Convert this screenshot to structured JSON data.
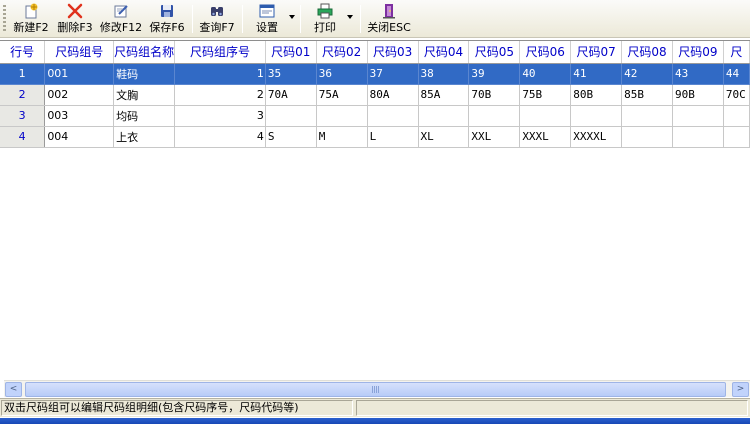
{
  "toolbar": {
    "buttons": [
      {
        "label": "新建F2",
        "icon": "new-document-icon"
      },
      {
        "label": "删除F3",
        "icon": "delete-x-icon"
      },
      {
        "label": "修改F12",
        "icon": "edit-icon"
      },
      {
        "label": "保存F6",
        "icon": "save-disk-icon"
      },
      {
        "label": "查询F7",
        "icon": "binoculars-icon"
      },
      {
        "label": "设置",
        "icon": "settings-window-icon"
      },
      {
        "label": "打印",
        "icon": "printer-icon"
      },
      {
        "label": "关闭ESC",
        "icon": "exit-door-icon"
      }
    ]
  },
  "grid": {
    "columns": [
      "行号",
      "尺码组号",
      "尺码组名称",
      "尺码组序号",
      "尺码01",
      "尺码02",
      "尺码03",
      "尺码04",
      "尺码05",
      "尺码06",
      "尺码07",
      "尺码08",
      "尺码09",
      "尺"
    ],
    "rows": [
      {
        "rn": "1",
        "code": "001",
        "name": "鞋码",
        "seq": "1",
        "sizes": [
          "35",
          "36",
          "37",
          "38",
          "39",
          "40",
          "41",
          "42",
          "43",
          "44"
        ],
        "selected": true
      },
      {
        "rn": "2",
        "code": "002",
        "name": "文胸",
        "seq": "2",
        "sizes": [
          "70A",
          "75A",
          "80A",
          "85A",
          "70B",
          "75B",
          "80B",
          "85B",
          "90B",
          "70C"
        ],
        "selected": false
      },
      {
        "rn": "3",
        "code": "003",
        "name": "均码",
        "seq": "3",
        "sizes": [
          "",
          "",
          "",
          "",
          "",
          "",
          "",
          "",
          "",
          ""
        ],
        "selected": false
      },
      {
        "rn": "4",
        "code": "004",
        "name": "上衣",
        "seq": "4",
        "sizes": [
          "S",
          "M",
          "L",
          "XL",
          "XXL",
          "XXXL",
          "XXXXL",
          "",
          "",
          ""
        ],
        "selected": false
      }
    ]
  },
  "scrollbar": {
    "left_arrow": "<",
    "right_arrow": ">"
  },
  "status": {
    "message": "双击尺码组可以编辑尺码组明细(包含尺码序号，尺码代码等)",
    "right": ""
  },
  "colors": {
    "selection": "#316ac5",
    "header_text": "#0000c8",
    "toolbar_bg": "#ece9d8"
  }
}
